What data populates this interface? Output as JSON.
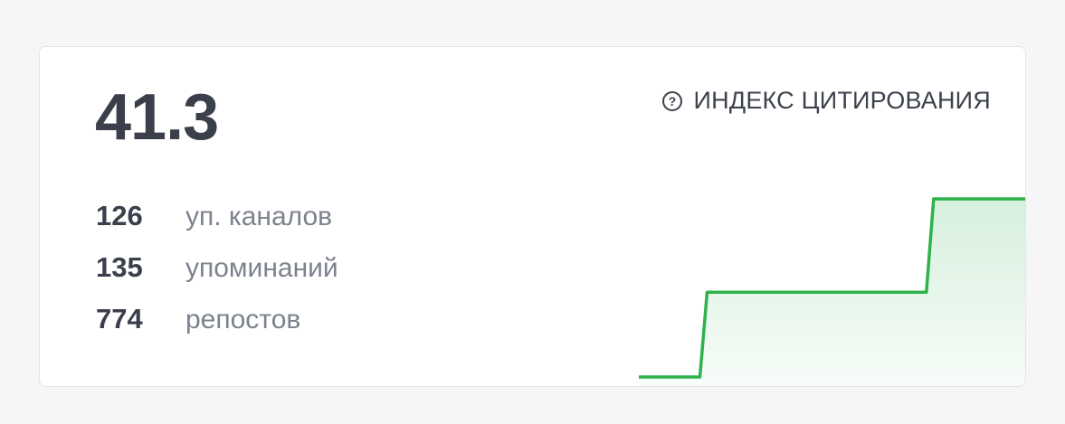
{
  "card": {
    "value": "41.3",
    "index_label": "ИНДЕКС ЦИТИРОВАНИЯ",
    "icon": "help-circle-icon",
    "stats": [
      {
        "value": "126",
        "label": "уп. каналов"
      },
      {
        "value": "135",
        "label": "упоминаний"
      },
      {
        "value": "774",
        "label": "репостов"
      }
    ]
  },
  "chart_data": {
    "type": "area",
    "step": true,
    "grid": false,
    "values": [
      0,
      0,
      1,
      1,
      1,
      1,
      1,
      1,
      1,
      2.1,
      2.1,
      2.1
    ],
    "ylim": [
      0,
      2.1
    ],
    "color": "#2fb24c",
    "fill": "#c9ebd2"
  }
}
